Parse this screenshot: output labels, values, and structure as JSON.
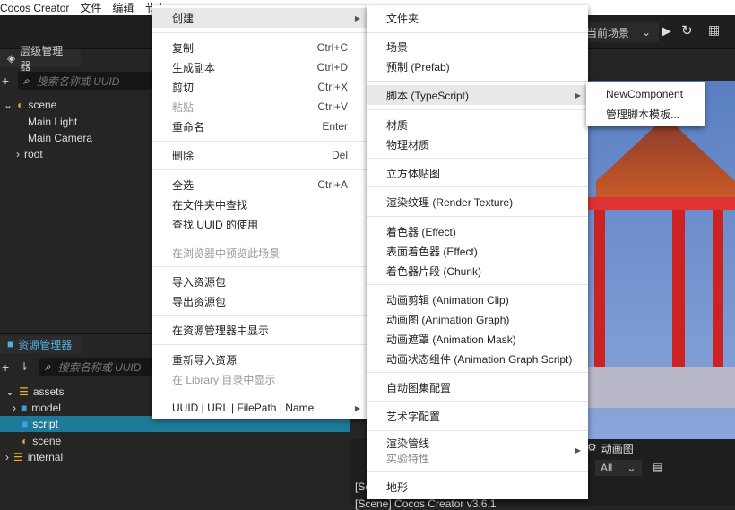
{
  "menubar": {
    "items": [
      "Cocos Creator",
      "文件",
      "编辑",
      "节点"
    ]
  },
  "toolbar": {
    "scene_select": "当前场景",
    "play_icon": "play-icon",
    "refresh_icon": "refresh-icon"
  },
  "hierarchy": {
    "title": "层级管理器",
    "search_placeholder": "搜索名称或 UUID",
    "items": [
      {
        "label": "scene"
      },
      {
        "label": "Main Light"
      },
      {
        "label": "Main Camera"
      },
      {
        "label": "root"
      }
    ]
  },
  "assets": {
    "title": "资源管理器",
    "search_placeholder": "搜索名称或 UUID",
    "items": [
      {
        "label": "assets"
      },
      {
        "label": "model"
      },
      {
        "label": "script"
      },
      {
        "label": "scene"
      },
      {
        "label": "internal"
      }
    ]
  },
  "bottom": {
    "tab_animgraph": "动画图",
    "filter": "All",
    "log1": "[Scene]",
    "log2": "[Scene] Cocos Creator v3.6.1"
  },
  "colors": {
    "selection": "#1f7a99",
    "accent_folder": "#3aa0e0"
  },
  "context_menu": {
    "create": "创建",
    "copy": "复制",
    "copy_sc": "Ctrl+C",
    "duplicate": "生成副本",
    "duplicate_sc": "Ctrl+D",
    "cut": "剪切",
    "cut_sc": "Ctrl+X",
    "paste": "粘贴",
    "paste_sc": "Ctrl+V",
    "rename": "重命名",
    "rename_sc": "Enter",
    "delete": "删除",
    "delete_sc": "Del",
    "select_all": "全选",
    "select_all_sc": "Ctrl+A",
    "find_in_folder": "在文件夹中查找",
    "find_uuid": "查找 UUID 的使用",
    "preview_browser": "在浏览器中预览此场景",
    "import_pkg": "导入资源包",
    "export_pkg": "导出资源包",
    "show_in_explorer": "在资源管理器中显示",
    "reimport": "重新导入资源",
    "show_library": "在 Library 目录中显示",
    "uuid_menu": "UUID | URL | FilePath | Name"
  },
  "create_menu": {
    "folder": "文件夹",
    "scene": "场景",
    "prefab": "预制 (Prefab)",
    "script": "脚本 (TypeScript)",
    "material": "材质",
    "physics_material": "物理材质",
    "cubemap": "立方体贴图",
    "render_texture": "渲染纹理 (Render Texture)",
    "effect": "着色器 (Effect)",
    "surface_effect": "表面着色器 (Effect)",
    "chunk": "着色器片段 (Chunk)",
    "anim_clip": "动画剪辑 (Animation Clip)",
    "anim_graph": "动画图 (Animation Graph)",
    "anim_mask": "动画遮罩 (Animation Mask)",
    "anim_graph_script": "动画状态组件 (Animation Graph Script)",
    "auto_atlas": "自动图集配置",
    "label_atlas": "艺术字配置",
    "render_pipeline": "渲染管线",
    "experimental": "实验特性",
    "terrain": "地形"
  },
  "script_menu": {
    "new_component": "NewComponent",
    "manage_templates": "管理脚本模板..."
  }
}
